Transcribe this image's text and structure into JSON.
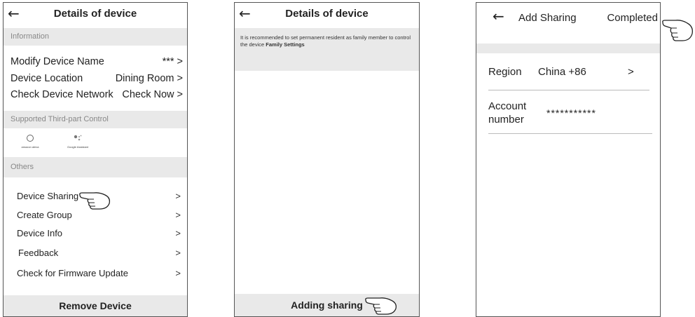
{
  "screen1": {
    "title": "Details of device",
    "section_information": "Information",
    "info_rows": [
      {
        "label": "Modify Device Name",
        "value": "*** >"
      },
      {
        "label": "Device Location",
        "value": "Dining Room >"
      },
      {
        "label": "Check Device Network",
        "value": "Check Now >"
      }
    ],
    "section_third_party": "Supported Third-part Control",
    "third_party": [
      {
        "label": "amazon alexa",
        "icon": "alexa-icon"
      },
      {
        "label": "Google Assistant",
        "icon": "google-assistant-icon"
      }
    ],
    "section_others": "Others",
    "others_rows": [
      {
        "label": "Device Sharing",
        "chevron": ">"
      },
      {
        "label": "Create Group",
        "chevron": ">"
      },
      {
        "label": "Device Info",
        "chevron": ">"
      },
      {
        "label": "Feedback",
        "chevron": ">"
      },
      {
        "label": "Check for Firmware Update",
        "chevron": ">"
      }
    ],
    "remove_label": "Remove Device"
  },
  "screen2": {
    "title": "Details of device",
    "notice_text": "It is recommended to set permanent resident as family member to control the device ",
    "notice_link": "Family Settings",
    "bottom_label": "Adding sharing"
  },
  "screen3": {
    "title": "Add Sharing",
    "completed_label": "Completed",
    "region_label": "Region",
    "region_value": "China +86",
    "region_chevron": ">",
    "account_label_line1": "Account",
    "account_label_line2": "number",
    "account_value": "***********"
  },
  "icons": {
    "back": "back-arrow-icon",
    "pointer": "pointing-hand-icon"
  },
  "colors": {
    "section_bg": "#e9e9e9",
    "section_text": "#888888",
    "border": "#555555"
  }
}
